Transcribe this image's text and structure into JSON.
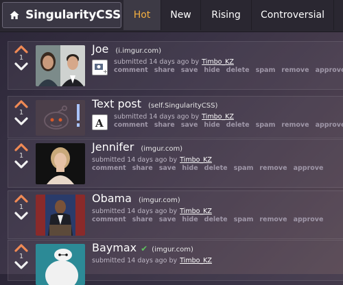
{
  "brand": {
    "title": "SingularityCSS"
  },
  "tabs": [
    {
      "label": "Hot",
      "active": true
    },
    {
      "label": "New"
    },
    {
      "label": "Rising"
    },
    {
      "label": "Controversial"
    }
  ],
  "colors": {
    "accent": "#f5b040",
    "upvote": "#f08a55",
    "checkmark": "#5fc25f"
  },
  "submitted_prefix": "submitted 14 days ago by",
  "actions": [
    "comment",
    "share",
    "save",
    "hide",
    "delete",
    "spam",
    "remove",
    "approve"
  ],
  "posts": [
    {
      "score": "1",
      "title": "Joe",
      "domain": "(i.imgur.com)",
      "author": "Timbo_KZ",
      "icon": "image-expand-icon",
      "thumbnail": "two-portrait-photos"
    },
    {
      "score": "1",
      "title": "Text post",
      "domain": "(self.SingularityCSS)",
      "author": "Timbo_KZ",
      "icon": "text-expand-icon",
      "thumbnail": "self-post-alien"
    },
    {
      "score": "1",
      "title": "Jennifer",
      "domain": "(imgur.com)",
      "author": "Timbo_KZ",
      "thumbnail": "portrait-photo"
    },
    {
      "score": "1",
      "title": "Obama",
      "domain": "(imgur.com)",
      "author": "Timbo_KZ",
      "thumbnail": "podium-photo"
    },
    {
      "score": "1",
      "title": "Baymax",
      "domain": "(imgur.com)",
      "author": "Timbo_KZ",
      "thumbnail": "baymax-photo",
      "verified": true
    }
  ]
}
